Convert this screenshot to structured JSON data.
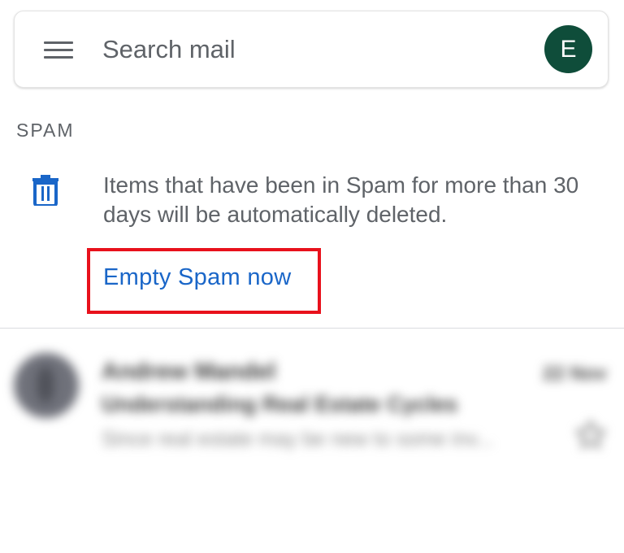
{
  "search": {
    "placeholder": "Search mail"
  },
  "account": {
    "initial": "E",
    "avatar_color": "#0f4d3a"
  },
  "section": {
    "label": "SPAM"
  },
  "notice": {
    "icon": "trash-icon",
    "text": "Items that have been in Spam for more than 30 days will be automatically deleted.",
    "action_label": "Empty Spam now",
    "accent_color": "#1a66c8",
    "highlight_color": "#e8111c"
  },
  "emails": [
    {
      "sender": "Andrew Mandel",
      "date": "22 Nov",
      "subject": "Understanding Real Estate Cycles",
      "snippet": "Since real estate may be new to some inv...",
      "icons": [
        "avatar",
        "star-icon"
      ]
    }
  ]
}
